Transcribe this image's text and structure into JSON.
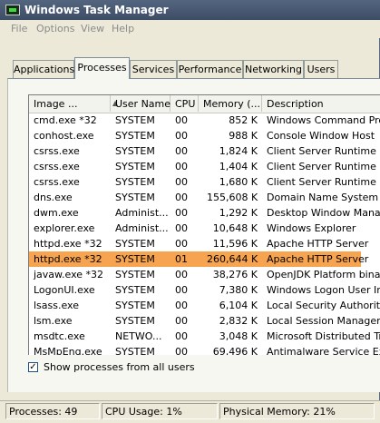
{
  "window": {
    "title": "Windows Task Manager"
  },
  "menu": [
    "File",
    "Options",
    "View",
    "Help"
  ],
  "tabs": [
    {
      "label": "Applications",
      "active": false
    },
    {
      "label": "Processes",
      "active": true
    },
    {
      "label": "Services",
      "active": false
    },
    {
      "label": "Performance",
      "active": false
    },
    {
      "label": "Networking",
      "active": false
    },
    {
      "label": "Users",
      "active": false
    }
  ],
  "table": {
    "columns": [
      "Image ...",
      "User Name",
      "CPU",
      "Memory (...",
      "Description"
    ],
    "rows": [
      {
        "image": "cmd.exe *32",
        "user": "SYSTEM",
        "cpu": "00",
        "memory": "852 K",
        "description": "Windows Command Proces"
      },
      {
        "image": "conhost.exe",
        "user": "SYSTEM",
        "cpu": "00",
        "memory": "988 K",
        "description": "Console Window Host"
      },
      {
        "image": "csrss.exe",
        "user": "SYSTEM",
        "cpu": "00",
        "memory": "1,824 K",
        "description": "Client Server Runtime Pro"
      },
      {
        "image": "csrss.exe",
        "user": "SYSTEM",
        "cpu": "00",
        "memory": "1,404 K",
        "description": "Client Server Runtime Pro"
      },
      {
        "image": "csrss.exe",
        "user": "SYSTEM",
        "cpu": "00",
        "memory": "1,680 K",
        "description": "Client Server Runtime Pro"
      },
      {
        "image": "dns.exe",
        "user": "SYSTEM",
        "cpu": "00",
        "memory": "155,608 K",
        "description": "Domain Name System (DN"
      },
      {
        "image": "dwm.exe",
        "user": "Administ...",
        "cpu": "00",
        "memory": "1,292 K",
        "description": "Desktop Window Manager"
      },
      {
        "image": "explorer.exe",
        "user": "Administ...",
        "cpu": "00",
        "memory": "10,648 K",
        "description": "Windows Explorer"
      },
      {
        "image": "httpd.exe *32",
        "user": "SYSTEM",
        "cpu": "00",
        "memory": "11,596 K",
        "description": "Apache HTTP Server"
      },
      {
        "image": "httpd.exe *32",
        "user": "SYSTEM",
        "cpu": "01",
        "memory": "260,644 K",
        "description": "Apache HTTP Server",
        "selected": true
      },
      {
        "image": "javaw.exe *32",
        "user": "SYSTEM",
        "cpu": "00",
        "memory": "38,276 K",
        "description": "OpenJDK Platform binary"
      },
      {
        "image": "LogonUI.exe",
        "user": "SYSTEM",
        "cpu": "00",
        "memory": "7,380 K",
        "description": "Windows Logon User Inter"
      },
      {
        "image": "lsass.exe",
        "user": "SYSTEM",
        "cpu": "00",
        "memory": "6,104 K",
        "description": "Local Security Authority P"
      },
      {
        "image": "lsm.exe",
        "user": "SYSTEM",
        "cpu": "00",
        "memory": "2,832 K",
        "description": "Local Session Manager Ser"
      },
      {
        "image": "msdtc.exe",
        "user": "NETWO...",
        "cpu": "00",
        "memory": "3,048 K",
        "description": "Microsoft Distributed Tran"
      },
      {
        "image": "MsMpEng.exe",
        "user": "SYSTEM",
        "cpu": "00",
        "memory": "69,496 K",
        "description": "Antimalware Service Execu"
      }
    ]
  },
  "show_all": {
    "label": "Show processes from all users",
    "checked": true
  },
  "status": {
    "processes": "Processes: 49",
    "cpu": "CPU Usage: 1%",
    "memory": "Physical Memory: 21%"
  },
  "colors": {
    "selection": "#f7a450",
    "titlebar": "#4a5b76"
  }
}
